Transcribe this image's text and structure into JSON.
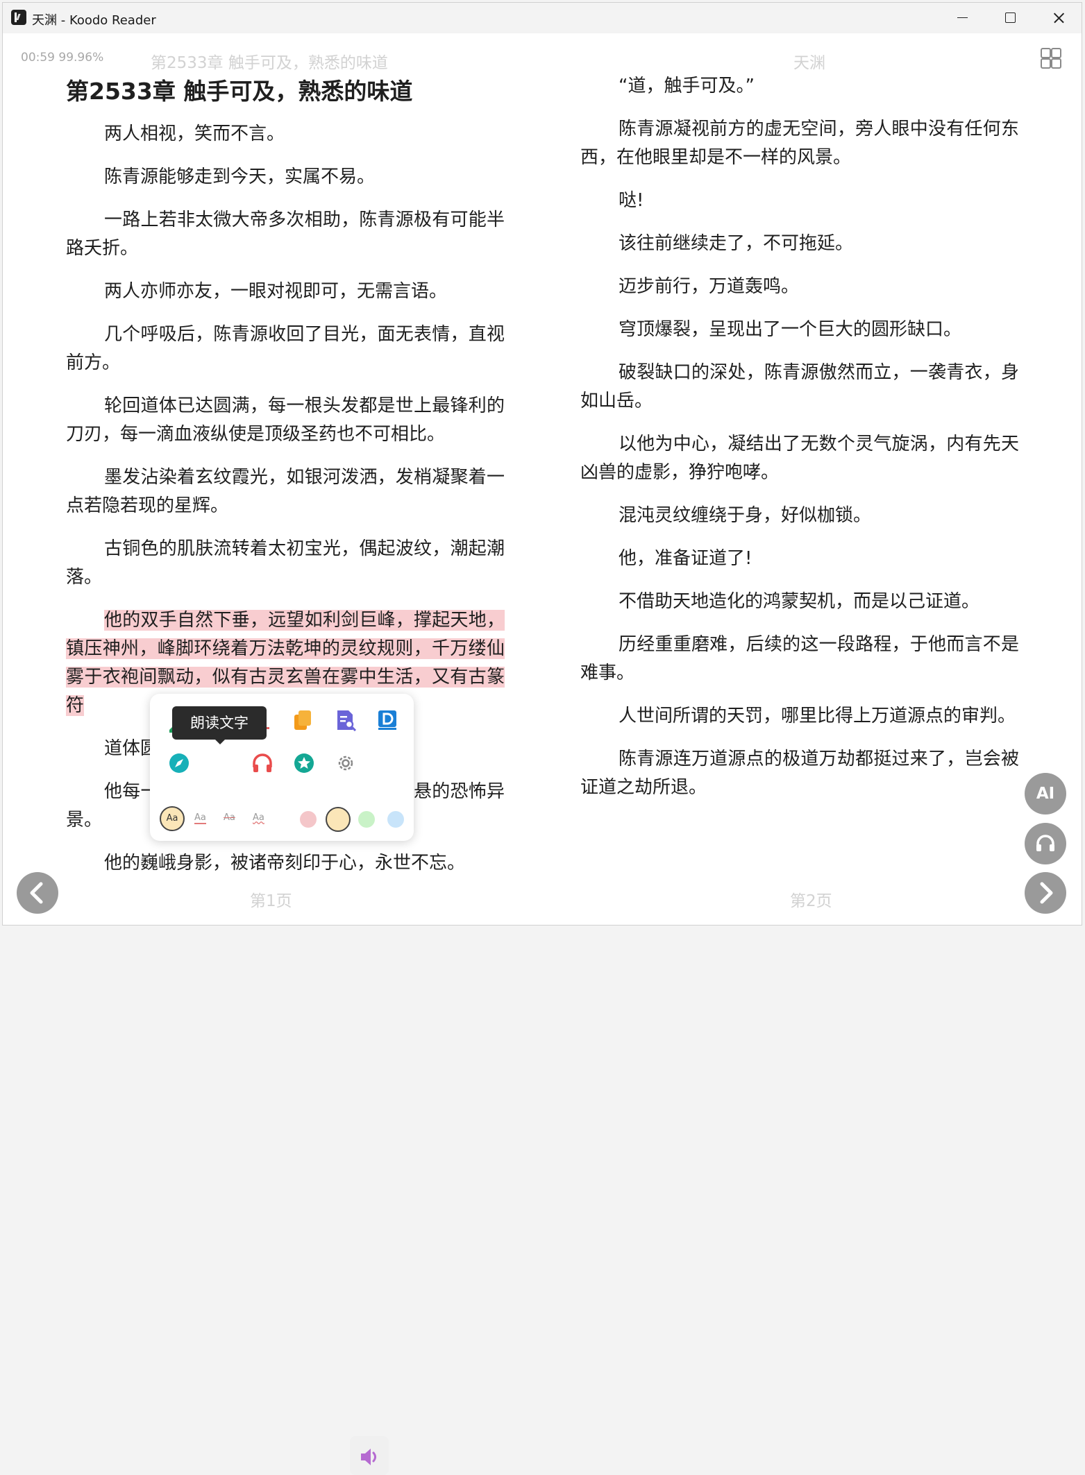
{
  "window": {
    "title": "天渊 - Koodo Reader"
  },
  "reader": {
    "status": "00:59 99.96%",
    "running_title_left": "第2533章 触手可及，熟悉的味道",
    "running_title_right": "天渊",
    "chapter_heading": "第2533章 触手可及，熟悉的味道",
    "left_paragraphs": [
      "两人相视，笑而不言。",
      "陈青源能够走到今天，实属不易。",
      "一路上若非太微大帝多次相助，陈青源极有可能半路夭折。",
      "两人亦师亦友，一眼对视即可，无需言语。",
      "几个呼吸后，陈青源收回了目光，面无表情，直视前方。",
      "轮回道体已达圆满，每一根头发都是世上最锋利的刀刃，每一滴血液纵使是顶级圣药也不可相比。",
      "墨发沾染着玄纹霞光，如银河泼洒，发梢凝聚着一点若隐若现的星辉。",
      "古铜色的肌肤流转着太初宝光，偶起波纹，潮起潮落。"
    ],
    "highlighted_paragraph": "他的双手自然下垂，远望如利剑巨峰，撑起天地，镇压神州，峰脚环绕着万法乾坤的灵纹规则，千万缕仙雾于衣袍间飘动，似有古灵玄兽在雾中生活，又有古篆符",
    "left_tail_paragraphs": [
      "道体圆",
      "他每一次吐纳，四方寰宇崩裂，星河倒悬的恐怖异景。",
      "他的巍峨身影，被诸帝刻印于心，永世不忘。"
    ],
    "right_paragraphs": [
      "“道，触手可及。”",
      "陈青源凝视前方的虚无空间，旁人眼中没有任何东西，在他眼里却是不一样的风景。",
      "哒!",
      "该往前继续走了，不可拖延。",
      "迈步前行，万道轰鸣。",
      "穹顶爆裂，呈现出了一个巨大的圆形缺口。",
      "破裂缺口的深处，陈青源傲然而立，一袭青衣，身如山岳。",
      "以他为中心，凝结出了无数个灵气旋涡，内有先天凶兽的虚影，狰狞咆哮。",
      "混沌灵纹缠绕于身，好似枷锁。",
      "他，准备证道了!",
      "不借助天地造化的鸿蒙契机，而是以己证道。",
      "历经重重磨难，后续的这一段路程，于他而言不是难事。",
      "人世间所谓的天罚，哪里比得上万道源点的审判。",
      "陈青源连万道源点的极道万劫都挺过来了，岂会被证道之劫所退。"
    ],
    "page_left": "第1页",
    "page_right": "第2页",
    "ai_label": "AI"
  },
  "popup": {
    "tooltip": "朗读文字",
    "style_sample": "Aa",
    "highlight_colors": [
      "#f4c6c9",
      "#fbe6b8",
      "#c9f2c7",
      "#c8e4fa"
    ],
    "selected_color_index": 1
  },
  "colors": {
    "highlight": "#f8cdd0",
    "nav_button": "#9a9a9a"
  }
}
